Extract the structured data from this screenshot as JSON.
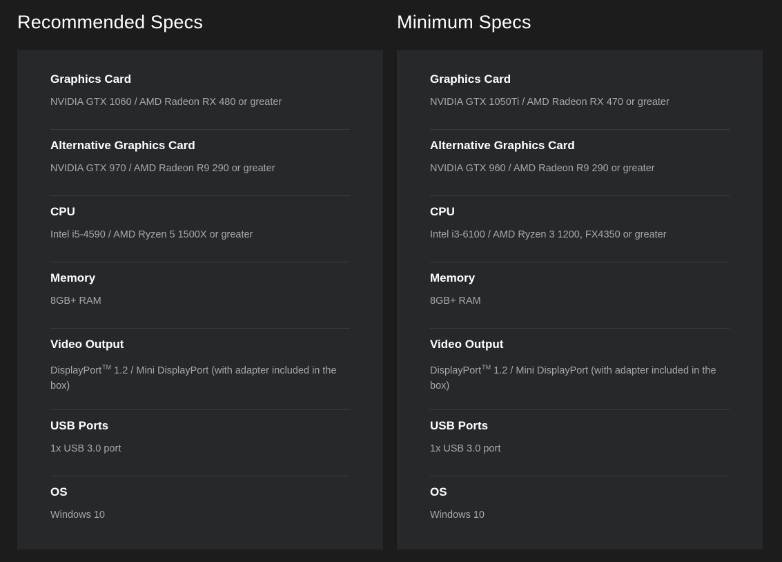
{
  "recommended": {
    "title": "Recommended Specs",
    "specs": [
      {
        "label": "Graphics Card",
        "value": "NVIDIA GTX 1060 / AMD Radeon RX 480 or greater"
      },
      {
        "label": "Alternative Graphics Card",
        "value": "NVIDIA GTX 970 / AMD Radeon R9 290 or greater"
      },
      {
        "label": "CPU",
        "value": "Intel i5-4590 / AMD Ryzen 5 1500X or greater"
      },
      {
        "label": "Memory",
        "value": "8GB+ RAM"
      },
      {
        "label": "Video Output",
        "value_prefix": "DisplayPort",
        "value_tm": "TM",
        "value_suffix": " 1.2 / Mini DisplayPort (with adapter included in the box)"
      },
      {
        "label": "USB Ports",
        "value": "1x USB 3.0 port"
      },
      {
        "label": "OS",
        "value": "Windows 10"
      }
    ]
  },
  "minimum": {
    "title": "Minimum Specs",
    "specs": [
      {
        "label": "Graphics Card",
        "value": "NVIDIA GTX 1050Ti / AMD Radeon RX 470 or greater"
      },
      {
        "label": "Alternative Graphics Card",
        "value": "NVIDIA GTX 960 / AMD Radeon R9 290 or greater"
      },
      {
        "label": "CPU",
        "value": "Intel i3-6100 / AMD Ryzen 3 1200, FX4350 or greater"
      },
      {
        "label": "Memory",
        "value": "8GB+ RAM"
      },
      {
        "label": "Video Output",
        "value_prefix": "DisplayPort",
        "value_tm": "TM",
        "value_suffix": " 1.2 / Mini DisplayPort (with adapter included in the box)"
      },
      {
        "label": "USB Ports",
        "value": "1x USB 3.0 port"
      },
      {
        "label": "OS",
        "value": "Windows 10"
      }
    ]
  }
}
